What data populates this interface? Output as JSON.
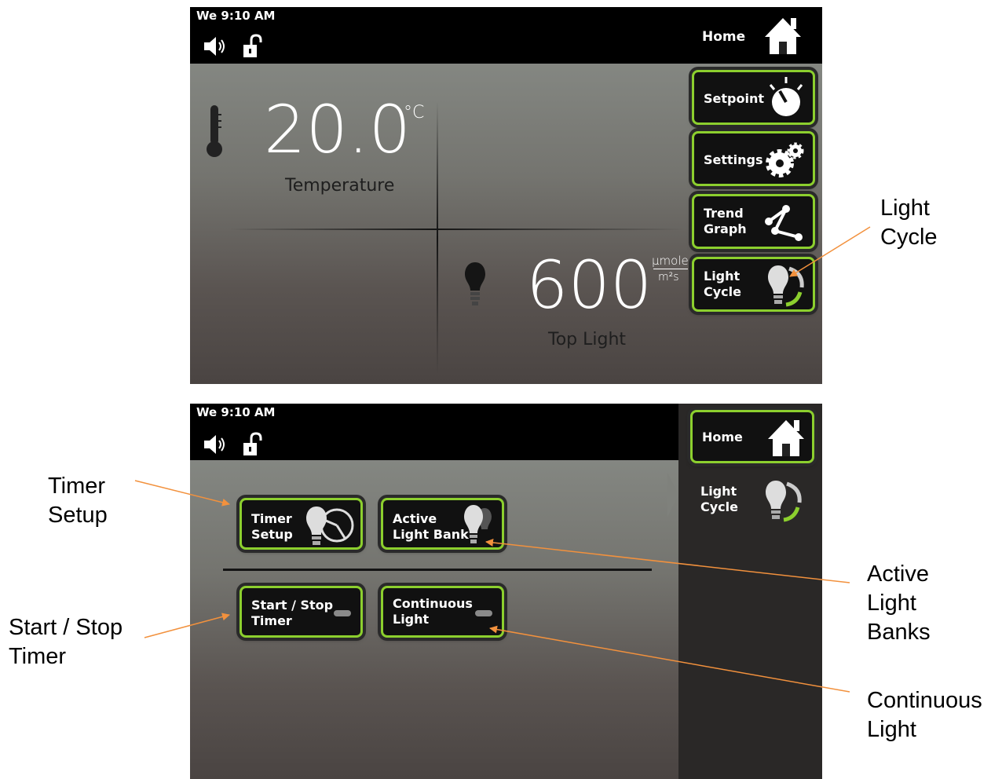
{
  "screen1": {
    "clock": "We 9:10 AM",
    "home_label": "Home",
    "temperature": {
      "value": "20.0",
      "unit": "°C",
      "label": "Temperature"
    },
    "light": {
      "value": "600",
      "unit_top": "µmole",
      "unit_bottom": "m²s",
      "label": "Top Light"
    },
    "side_buttons": [
      {
        "label": "Setpoint"
      },
      {
        "label": "Settings"
      },
      {
        "label": "Trend\nGraph"
      },
      {
        "label": "Light\nCycle"
      }
    ]
  },
  "screen2": {
    "clock": "We 9:10 AM",
    "home_label": "Home",
    "current_page": "Light\nCycle",
    "buttons": [
      {
        "label": "Timer\nSetup"
      },
      {
        "label": "Active\nLight Bank"
      },
      {
        "label": "Start / Stop\nTimer"
      },
      {
        "label": "Continuous\nLight"
      }
    ]
  },
  "annotations": {
    "light_cycle": "Light\nCycle",
    "timer_setup": "Timer\nSetup",
    "start_stop_timer": "Start / Stop\nTimer",
    "active_light_banks": "Active\nLight\nBanks",
    "continuous_light": "Continuous\nLight"
  },
  "colors": {
    "accent_green": "#8ccf2e",
    "arrow": "#f2913d"
  }
}
